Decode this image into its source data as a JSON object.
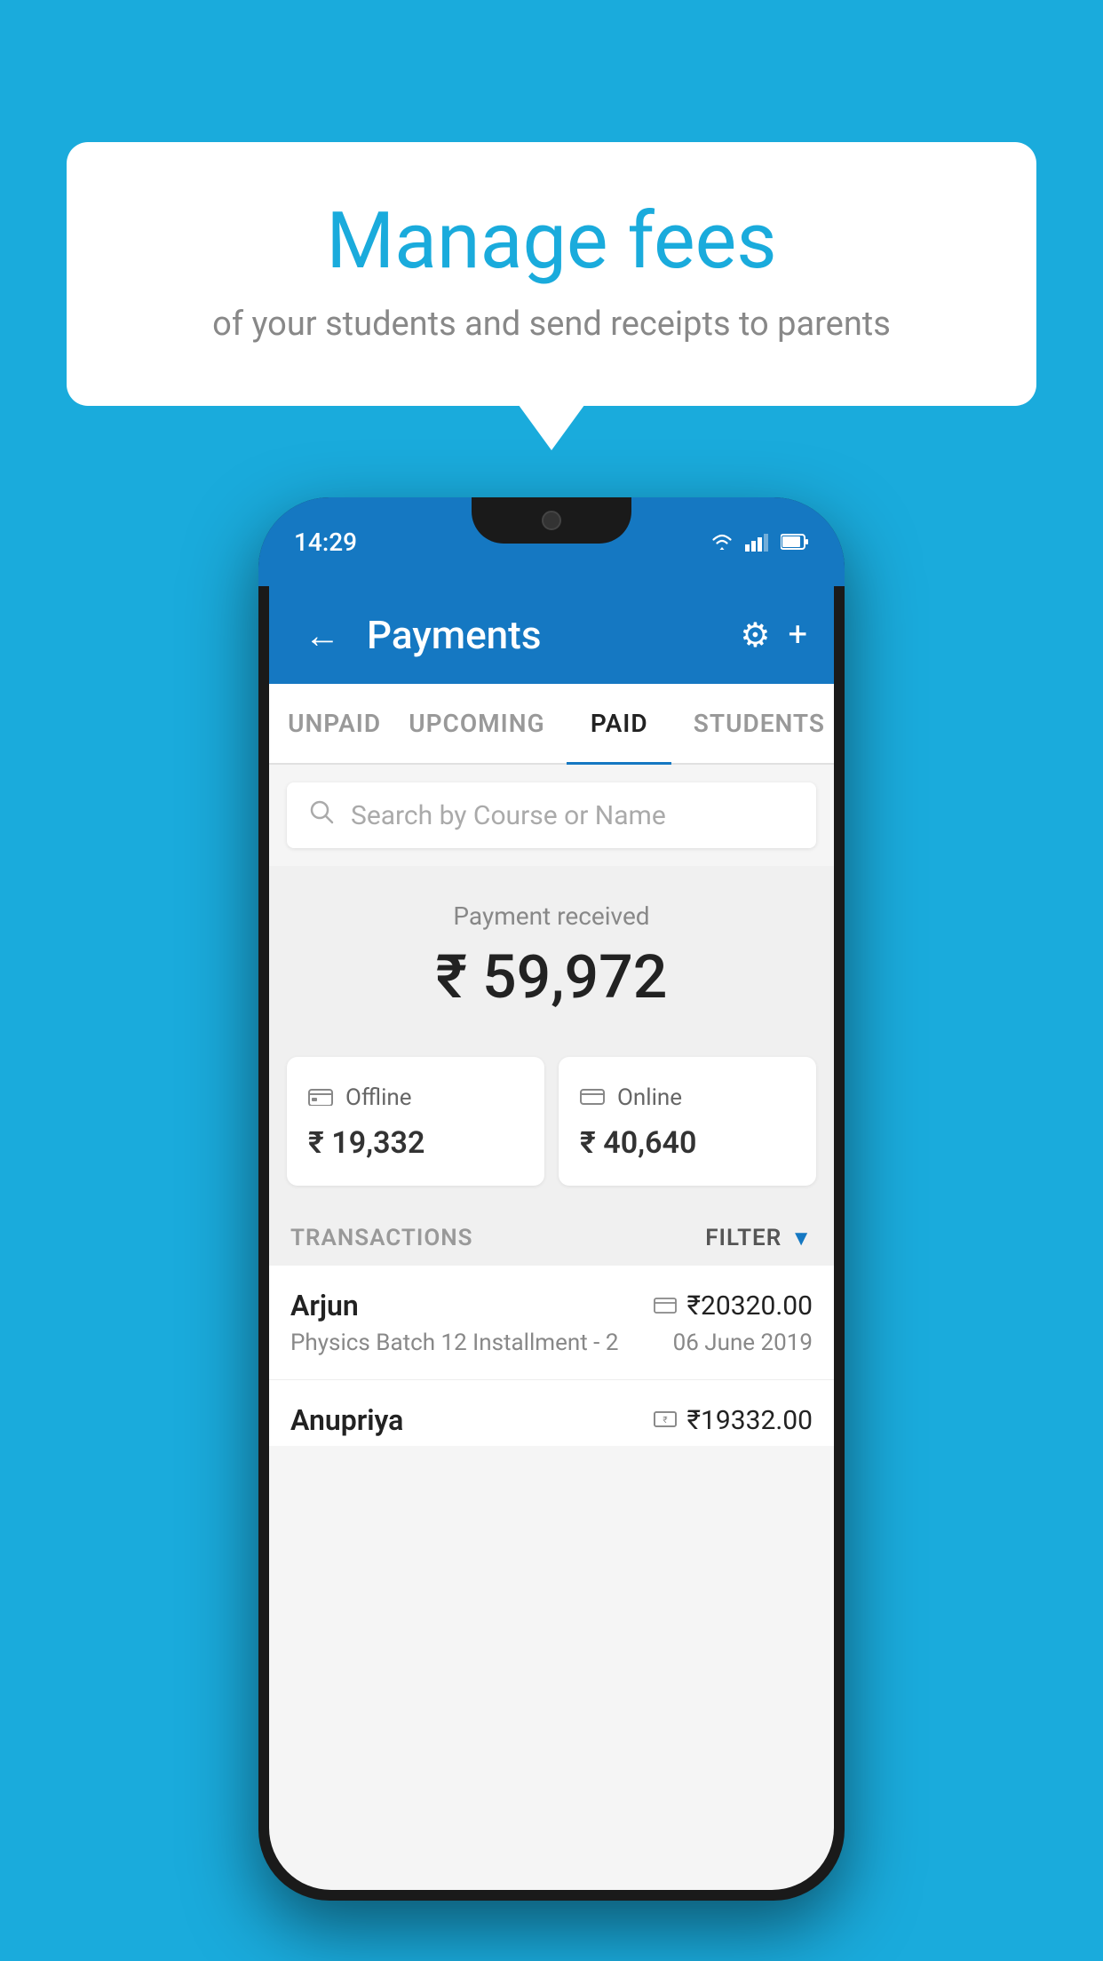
{
  "background_color": "#1AABDC",
  "speech_bubble": {
    "title": "Manage fees",
    "subtitle": "of your students and send receipts to parents"
  },
  "phone": {
    "status_bar": {
      "time": "14:29",
      "icons": [
        "wifi",
        "signal",
        "battery"
      ]
    },
    "app_bar": {
      "title": "Payments",
      "back_icon": "←",
      "settings_icon": "⚙",
      "add_icon": "+"
    },
    "tabs": [
      {
        "label": "UNPAID",
        "active": false
      },
      {
        "label": "UPCOMING",
        "active": false
      },
      {
        "label": "PAID",
        "active": true
      },
      {
        "label": "STUDENTS",
        "active": false
      }
    ],
    "search": {
      "placeholder": "Search by Course or Name"
    },
    "payment_summary": {
      "label": "Payment received",
      "amount": "₹ 59,972",
      "offline_label": "Offline",
      "offline_amount": "₹ 19,332",
      "online_label": "Online",
      "online_amount": "₹ 40,640"
    },
    "transactions": {
      "section_label": "TRANSACTIONS",
      "filter_label": "FILTER",
      "rows": [
        {
          "name": "Arjun",
          "amount": "₹20320.00",
          "type_icon": "card",
          "description": "Physics Batch 12 Installment - 2",
          "date": "06 June 2019"
        },
        {
          "name": "Anupriya",
          "amount": "₹19332.00",
          "type_icon": "cash",
          "description": "",
          "date": ""
        }
      ]
    }
  }
}
